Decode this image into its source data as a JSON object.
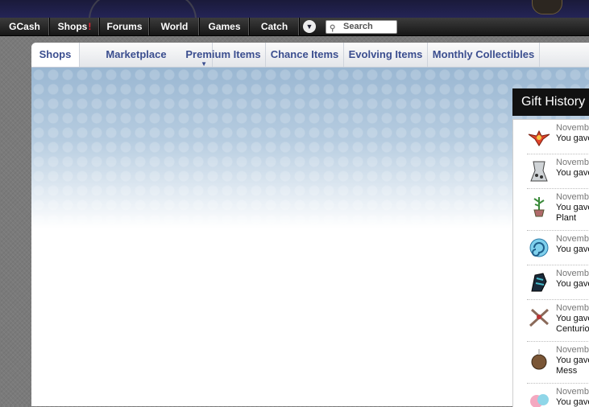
{
  "nav": {
    "items": [
      {
        "label": "GCash"
      },
      {
        "label": "Shops",
        "alert": "!"
      },
      {
        "label": "Forums"
      },
      {
        "label": "World"
      },
      {
        "label": "Games"
      },
      {
        "label": "Catch"
      }
    ],
    "dropdown_icon": "chevron-down-icon",
    "search_placeholder": "Search"
  },
  "tabs": [
    {
      "label": "Shops"
    },
    {
      "label": "Marketplace"
    },
    {
      "label": "Premium Items"
    },
    {
      "label": "Chance Items"
    },
    {
      "label": "Evolving Items"
    },
    {
      "label": "Monthly Collectibles"
    }
  ],
  "gift_history": {
    "title": "Gift History",
    "items": [
      {
        "date": "Novemb",
        "line1": "You gave",
        "line2": "",
        "icon": "winged-emblem-icon"
      },
      {
        "date": "Novemb",
        "line1": "You gave",
        "line2": "",
        "icon": "stone-tablet-icon"
      },
      {
        "date": "Novemb",
        "line1": "You gave",
        "line2": "Plant",
        "icon": "potted-plant-icon"
      },
      {
        "date": "Novemb",
        "line1": "You gave",
        "line2": "",
        "icon": "blue-swirl-icon"
      },
      {
        "date": "Novemb",
        "line1": "You gave",
        "line2": "",
        "icon": "dark-creature-icon"
      },
      {
        "date": "Novemb",
        "line1": "You gave",
        "line2": "Centurio",
        "icon": "crossed-swords-icon"
      },
      {
        "date": "Novemb",
        "line1": "You gave",
        "line2": "Mess",
        "icon": "coconut-icon"
      },
      {
        "date": "Novemb",
        "line1": "You gave",
        "line2": "",
        "icon": "pink-creature-icon"
      }
    ]
  }
}
